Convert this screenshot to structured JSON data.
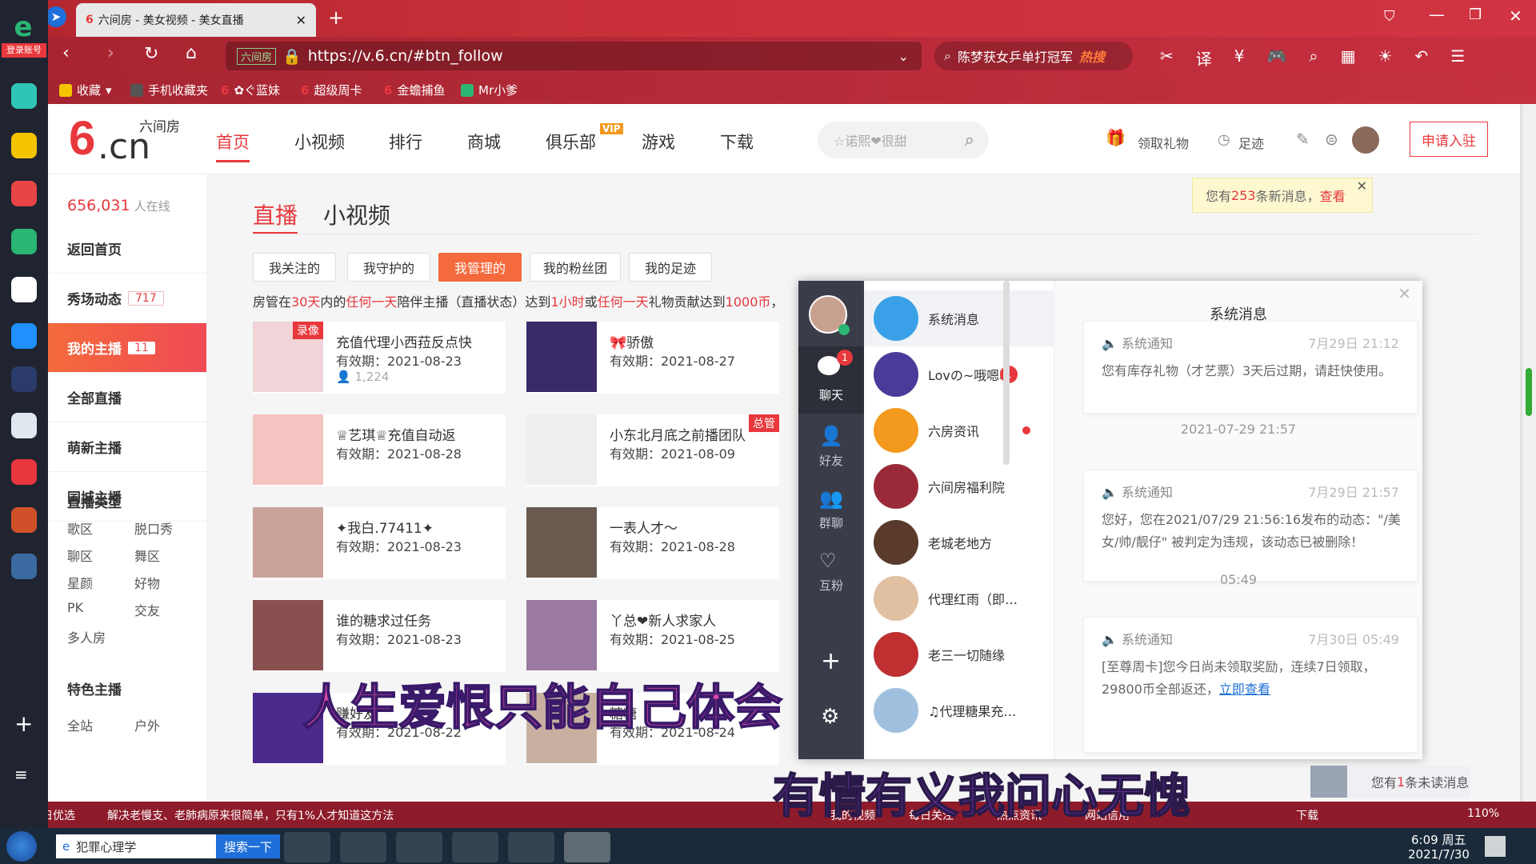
{
  "browser": {
    "tab_title": "六间房 - 美女视频 - 美女直播",
    "url_site": "六间房",
    "url": "https://v.6.cn/#btn_follow",
    "search_text": "陈梦获女乒单打冠军",
    "hot_label": "热搜",
    "login_label": "登录账号",
    "zoom": "110%"
  },
  "bookmarks": [
    {
      "label": "收藏",
      "color": "#f5c400"
    },
    {
      "label": "手机收藏夹",
      "color": "#555"
    },
    {
      "label": "✿ぐ蓝妹",
      "color": "#e8383d"
    },
    {
      "label": "超级周卡",
      "color": "#e8383d"
    },
    {
      "label": "金蟾捕鱼",
      "color": "#e8383d"
    },
    {
      "label": "Mr小爹",
      "color": "#2bb673"
    }
  ],
  "site": {
    "logo_text": ".cn",
    "logo_sub": "六间房",
    "nav": [
      "首页",
      "小视频",
      "排行",
      "商城",
      "俱乐部",
      "游戏",
      "下载"
    ],
    "vip_badge": "VIP",
    "search_placeholder": "☆诺熙❤很甜",
    "gift_label": "领取礼物",
    "footprint_label": "足迹",
    "apply_label": "申请入驻",
    "notice_prefix": "您有",
    "notice_count": "253",
    "notice_mid": "条新消息，",
    "notice_link": "查看"
  },
  "sidebar": {
    "online_count": "656,031",
    "online_label": "人在线",
    "items": [
      {
        "label": "返回首页",
        "badge": ""
      },
      {
        "label": "秀场动态",
        "badge": "717"
      },
      {
        "label": "我的主播",
        "badge": "11"
      },
      {
        "label": "全部直播",
        "badge": ""
      },
      {
        "label": "萌新主播",
        "badge": ""
      },
      {
        "label": "同城主播",
        "badge": ""
      }
    ],
    "type_title": "直播类型",
    "types": [
      "歌区",
      "脱口秀",
      "聊区",
      "舞区",
      "星颜",
      "好物",
      "PK",
      "交友",
      "多人房"
    ],
    "special_title": "特色主播",
    "special_sub": [
      "全站",
      "户外"
    ]
  },
  "main": {
    "tabs": [
      "直播",
      "小视频"
    ],
    "filters": [
      "我关注的",
      "我守护的",
      "我管理的",
      "我的粉丝团",
      "我的足迹"
    ],
    "desc_parts": [
      "房管在",
      "30天",
      "内的",
      "任何一天",
      "陪伴主播（直播状态）达到",
      "1小时",
      "或",
      "任何一天",
      "礼物贡献达到",
      "1000币",
      "，"
    ],
    "cards": [
      {
        "title": "充值代理小西菈反点快",
        "valid": "有效期：2021-08-23",
        "fans": "1,224",
        "badge": "录像",
        "color": "#f0d4d8"
      },
      {
        "title": "🎀骄傲",
        "valid": "有效期：2021-08-27",
        "fans": "",
        "badge": "",
        "color": "#3a2a6a"
      },
      {
        "title": "♕艺琪♕充值自动返",
        "valid": "有效期：2021-08-28",
        "fans": "",
        "badge": "",
        "color": "#f4c4c0"
      },
      {
        "title": "小东北月底之前播团队",
        "valid": "有效期：2021-08-09",
        "fans": "",
        "badge": "总管",
        "color": "#eeeeee"
      },
      {
        "title": "✦我白.77411✦",
        "valid": "有效期：2021-08-23",
        "fans": "",
        "badge": "",
        "color": "#c9a39a"
      },
      {
        "title": "一表人才～",
        "valid": "有效期：2021-08-28",
        "fans": "",
        "badge": "",
        "color": "#6a5a50"
      },
      {
        "title": "谁的糖求过任务",
        "valid": "有效期：2021-08-23",
        "fans": "",
        "badge": "",
        "color": "#8a5050"
      },
      {
        "title": "丫总❤新人求家人",
        "valid": "有效期：2021-08-25",
        "fans": "",
        "badge": "",
        "color": "#9a7aa0"
      },
      {
        "title": "赚好友",
        "valid": "有效期：2021-08-22",
        "fans": "",
        "badge": "",
        "color": "#4a2a8a"
      },
      {
        "title": "糖糖",
        "valid": "有效期：2021-08-24",
        "fans": "",
        "badge": "",
        "color": "#c8b0a0"
      }
    ]
  },
  "chat": {
    "nav": [
      {
        "label": "聊天",
        "badge": "1"
      },
      {
        "label": "好友",
        "badge": ""
      },
      {
        "label": "群聊",
        "badge": ""
      },
      {
        "label": "互粉",
        "badge": ""
      }
    ],
    "list": [
      {
        "name": "系统消息",
        "color": "#3aa0e8",
        "badge": ""
      },
      {
        "name": "Lovの~哦嗯呢",
        "color": "#4a3a9a",
        "badge": "1"
      },
      {
        "name": "六房资讯",
        "color": "#f39a1e",
        "badge": "dot"
      },
      {
        "name": "六间房福利院",
        "color": "#9a2a3a",
        "badge": ""
      },
      {
        "name": "老城老地方",
        "color": "#5a3a2a",
        "badge": ""
      },
      {
        "name": "代理红雨（即…",
        "color": "#e0c0a0",
        "badge": ""
      },
      {
        "name": "老三一切随缘",
        "color": "#c03030",
        "badge": ""
      },
      {
        "name": "♫代理糖果充…",
        "color": "#a0c0e0",
        "badge": ""
      }
    ],
    "panel_title": "系统消息",
    "messages": [
      {
        "head": "系统通知",
        "time": "7月29日 21:12",
        "body": "您有库存礼物（才艺票）3天后过期，请赶快使用。",
        "link": ""
      },
      {
        "head": "系统通知",
        "time": "7月29日 21:57",
        "body": "您好，您在2021/07/29 21:56:16发布的动态：\"/美女/帅/靓仔\" 被判定为违规，该动态已被删除！",
        "link": ""
      },
      {
        "head": "系统通知",
        "time": "7月30日 05:49",
        "body": "[至尊周卡]您今日尚未领取奖励，连续7日领取，29800币全部返还，",
        "link": "立即查看"
      }
    ],
    "stamps": [
      "2021-07-29 21:57",
      "05:49"
    ],
    "unread_prefix": "您有",
    "unread_count": "1",
    "unread_suffix": "条未读消息"
  },
  "overlay": {
    "line1": "人生爱恨只能自己体会",
    "line2": "有情有义我问心无愧"
  },
  "statusbar": {
    "left1": "今日优选",
    "left2": "解决老慢支、老肺病原来很简单，只有1%人才知道这方法",
    "items": [
      "我的视频",
      "每日关注",
      "热点资讯",
      "网站信用",
      "下载"
    ]
  },
  "taskbar": {
    "search_item": "犯罪心理学",
    "search_btn": "搜索一下",
    "time": "6:09 周五",
    "date": "2021/7/30"
  }
}
